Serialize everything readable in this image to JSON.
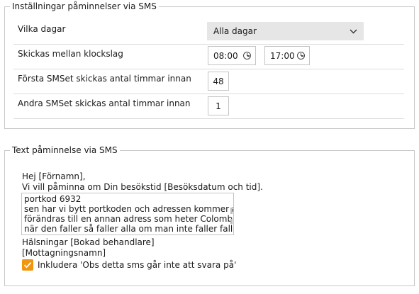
{
  "sms_settings": {
    "legend": "Inställningar påminnelser via SMS",
    "days_label": "Vilka dagar",
    "days_value": "Alla dagar",
    "between_label": "Skickas mellan klockslag",
    "time_from": "08:00",
    "time_to": "17:00",
    "first_label": "Första SMSet skickas antal timmar innan",
    "first_value": "48",
    "second_label": "Andra SMSet skickas antal timmar innan",
    "second_value": "1"
  },
  "sms_text": {
    "legend": "Text påminnelse via SMS",
    "greeting": "Hej [Förnamn],",
    "intro": "Vi vill påminna om Din besökstid [Besöksdatum och tid].",
    "body_lines": [
      "portkod 6932",
      "sen har vi bytt portkoden och adressen kommer att",
      "förändras till en annan adress som heter Colombus och",
      "när den faller så faller alla om man inte faller fallaffel"
    ],
    "regards": "Hälsningar [Bokad behandlare]",
    "receiver": "[Mottagningsnamn]",
    "checkbox_label": "Inkludera 'Obs detta sms går inte att svara på'",
    "checkbox_checked": true
  },
  "colors": {
    "accent": "#f0960f",
    "select_bg": "#e6e6e6",
    "border": "#c4c4c4"
  }
}
